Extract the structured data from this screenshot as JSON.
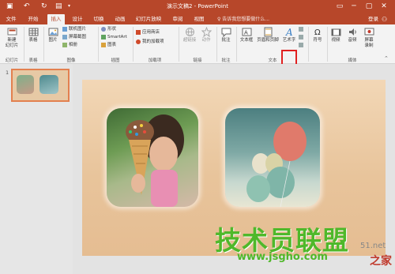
{
  "window": {
    "title": "演示文稿2 - PowerPoint",
    "minimize": "─",
    "restore": "▢",
    "close": "✕"
  },
  "tabs": [
    "文件",
    "开始",
    "插入",
    "设计",
    "切换",
    "动画",
    "幻灯片放映",
    "审阅",
    "视图"
  ],
  "active_tab": "插入",
  "search_placeholder": "♀ 告诉我您想要做什么...",
  "account": {
    "login": "登录",
    "share_icon": "share-icon"
  },
  "ribbon": {
    "slides": {
      "new_slide": "新建\n幻灯片",
      "group": "幻灯片"
    },
    "tables": {
      "table": "表格",
      "group": "表格"
    },
    "images": {
      "picture": "图片",
      "online_picture": "联机图片",
      "screenshot": "屏幕截图",
      "album": "相册",
      "group": "图像"
    },
    "illustrations": {
      "shapes": "形状",
      "smartart": "SmartArt",
      "chart": "图表",
      "group": "插图"
    },
    "addins": {
      "store": "应用商店",
      "my_addins": "我的加载项",
      "group": "加载项"
    },
    "links": {
      "hyperlink": "超链接",
      "action": "动作",
      "group": "链接"
    },
    "comments": {
      "comment": "批注",
      "group": "批注"
    },
    "text": {
      "textbox": "文本框",
      "header_footer": "页眉和页脚",
      "wordart": "艺术字",
      "group": "文本"
    },
    "symbols": {
      "symbol": "符号"
    },
    "media": {
      "video": "视频",
      "audio": "音频",
      "screen_record": "屏幕\n录制",
      "group": "媒体"
    }
  },
  "slide_panel": {
    "slide_number": "1"
  },
  "watermark": {
    "main": "技术员联盟",
    "url": "www.jsgho.com",
    "side": "51.net",
    "side2": "之家"
  },
  "colors": {
    "accent": "#b7472a",
    "highlight": "#e02020",
    "watermark": "#4fb82a"
  }
}
